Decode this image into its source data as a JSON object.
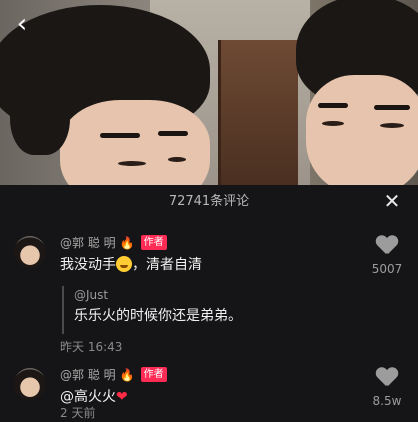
{
  "video": {
    "back_glyph": "‹"
  },
  "comments_panel": {
    "title": "72741条评论",
    "close_glyph": "✕"
  },
  "comments": [
    {
      "author": "@郭 聪 明",
      "badge": "作者",
      "text_before_emoji": "我没动手",
      "text_after_emoji": "，清者自清",
      "reply": {
        "user": "@Just",
        "text": "乐乐火的时候你还是弟弟。"
      },
      "time": "昨天 16:43",
      "likes": "5007"
    },
    {
      "author": "@郭 聪 明",
      "badge": "作者",
      "text": "@高火火",
      "time": "2 天前",
      "likes": "8.5w"
    }
  ]
}
